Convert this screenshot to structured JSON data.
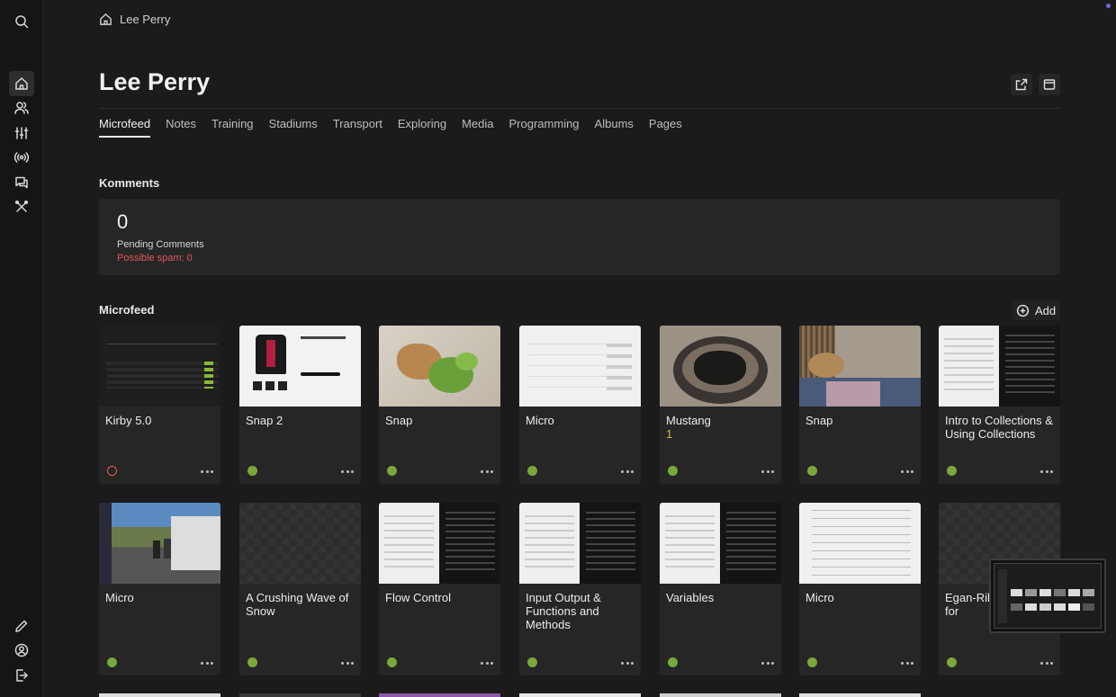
{
  "breadcrumb": {
    "label": "Lee Perry"
  },
  "page": {
    "title": "Lee Perry"
  },
  "tabs": [
    {
      "label": "Microfeed",
      "active": true
    },
    {
      "label": "Notes"
    },
    {
      "label": "Training"
    },
    {
      "label": "Stadiums"
    },
    {
      "label": "Transport"
    },
    {
      "label": "Exploring"
    },
    {
      "label": "Media"
    },
    {
      "label": "Programming"
    },
    {
      "label": "Albums"
    },
    {
      "label": "Pages"
    }
  ],
  "komments": {
    "heading": "Komments",
    "count": "0",
    "pending_label": "Pending Comments",
    "spam_label": "Possible spam: 0"
  },
  "microfeed": {
    "heading": "Microfeed",
    "add_label": "Add",
    "cards": [
      {
        "title": "Kirby 5.0",
        "status": "draft",
        "thumb": "dark-ui"
      },
      {
        "title": "Snap 2",
        "status": "published",
        "thumb": "shirt"
      },
      {
        "title": "Snap",
        "status": "published",
        "thumb": "dog-toy"
      },
      {
        "title": "Micro",
        "status": "published",
        "thumb": "light-ui"
      },
      {
        "title": "Mustang",
        "subtitle": "1",
        "status": "published",
        "thumb": "dog-bed"
      },
      {
        "title": "Snap",
        "status": "published",
        "thumb": "dog-sofa"
      },
      {
        "title": "Intro to Collections & Using Collections",
        "status": "published",
        "thumb": "split-ui"
      },
      {
        "title": "Micro",
        "status": "published",
        "thumb": "road"
      },
      {
        "title": "A Crushing Wave of Snow",
        "status": "published",
        "thumb": "empty"
      },
      {
        "title": "Flow Control",
        "status": "published",
        "thumb": "split-ui"
      },
      {
        "title": "Input Output & Functions and Methods",
        "status": "published",
        "thumb": "split-ui"
      },
      {
        "title": "Variables",
        "status": "published",
        "thumb": "split-ui"
      },
      {
        "title": "Micro",
        "status": "published",
        "thumb": "article"
      },
      {
        "title": "Egan-Riley to leave for",
        "status": "published",
        "thumb": "empty"
      }
    ]
  },
  "colors": {
    "background": "#1b1b1b",
    "panel": "#262626",
    "status_published": "#7aa83a",
    "status_draft": "#e05a5a"
  },
  "icons": [
    "search-icon",
    "home-icon",
    "users-icon",
    "sliders-icon",
    "broadcast-icon",
    "chat-icon",
    "tools-icon",
    "pencil-icon",
    "account-icon",
    "logout-icon",
    "open-external-icon",
    "layout-icon",
    "add-circle-icon",
    "more-icon"
  ]
}
